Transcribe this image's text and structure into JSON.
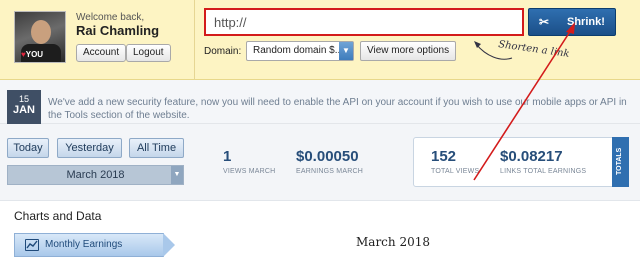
{
  "user": {
    "welcome": "Welcome back,",
    "name": "Rai Chamling",
    "account_button": "Account",
    "logout_button": "Logout",
    "avatar_tag": "YOU"
  },
  "shortener": {
    "url_placeholder": "http://",
    "shrink_button": "Shrink!",
    "domain_label": "Domain:",
    "domain_selected": "Random domain $...",
    "view_more_button": "View more options",
    "annotation": "Shorten a link"
  },
  "notice": {
    "day": "15",
    "month": "JAN",
    "text": "We've add a new security feature, now you will need to enable the API on your account if you wish to use our mobile apps or API in the Tools section of the website."
  },
  "filters": {
    "today": "Today",
    "yesterday": "Yesterday",
    "all_time": "All Time",
    "selected_month": "March 2018"
  },
  "stats": {
    "views_month": {
      "value": "1",
      "label": "VIEWS MARCH"
    },
    "earnings_month": {
      "value": "$0.00050",
      "label": "EARNINGS MARCH"
    },
    "total_views": {
      "value": "152",
      "label": "TOTAL VIEWS"
    },
    "links_total_earnings": {
      "value": "$0.08217",
      "label": "LINKS TOTAL EARNINGS"
    },
    "totals_tab": "TOTALS"
  },
  "charts": {
    "title": "Charts and Data",
    "tab_monthly": "Monthly Earnings",
    "chart_month": "March 2018"
  },
  "colors": {
    "header_bg": "#fdf4c3",
    "highlight": "#d31b1b",
    "accent": "#2f6fb0"
  }
}
